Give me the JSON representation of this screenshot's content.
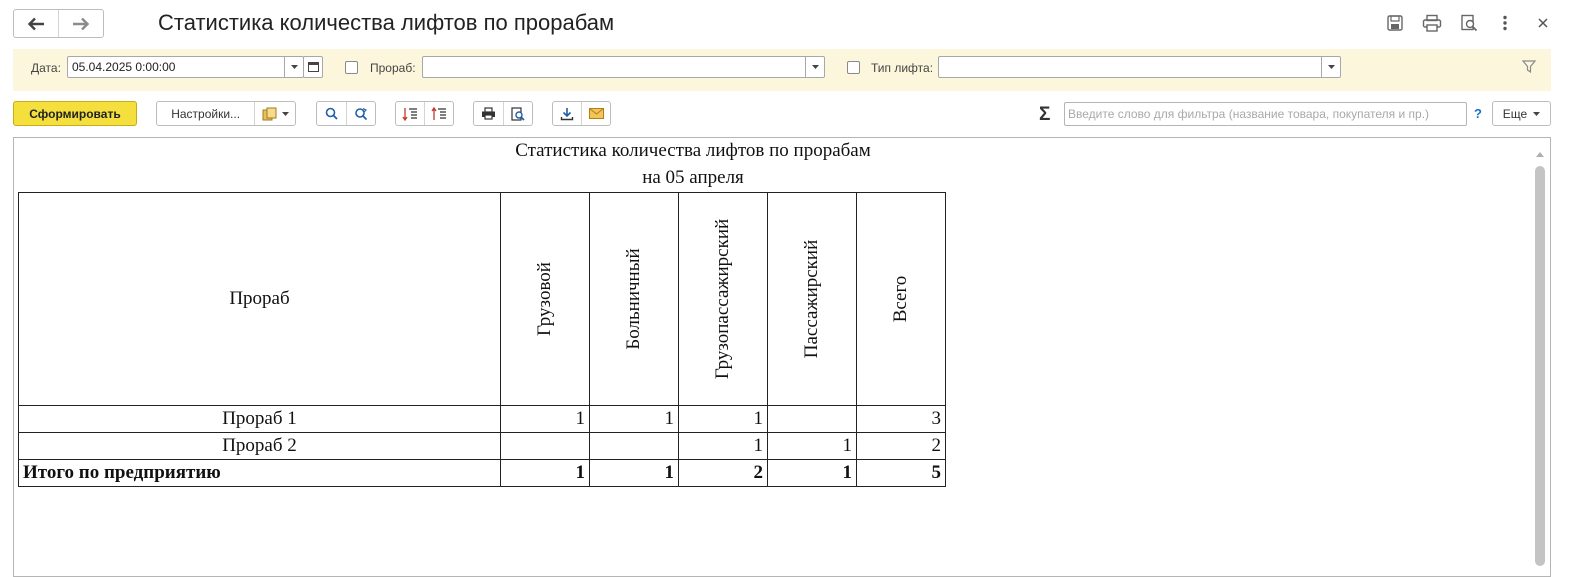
{
  "window": {
    "title": "Статистика количества лифтов по прорабам"
  },
  "filters": {
    "date_label": "Дата:",
    "date_value": "05.04.2025  0:00:00",
    "foreman_label": "Прораб:",
    "foreman_value": "",
    "lift_type_label": "Тип лифта:",
    "lift_type_value": ""
  },
  "toolbar": {
    "generate_label": "Сформировать",
    "settings_label": "Настройки...",
    "search_placeholder": "Введите слово для фильтра (название товара, покупателя и пр.)",
    "help_label": "?",
    "more_label": "Еще",
    "sum_label": "Σ"
  },
  "report": {
    "title": "Статистика количества лифтов по прорабам",
    "subtitle": "на 05 апреля",
    "columns": [
      "Прораб",
      "Грузовой",
      "Больничный",
      "Грузопассажирский",
      "Пассажирский",
      "Всего"
    ],
    "rows": [
      {
        "name": "Прораб 1",
        "values": [
          "1",
          "1",
          "1",
          "",
          "3"
        ]
      },
      {
        "name": "Прораб 2",
        "values": [
          "",
          "",
          "1",
          "1",
          "2"
        ]
      }
    ],
    "total": {
      "name": "Итого по предприятию",
      "values": [
        "1",
        "1",
        "2",
        "1",
        "5"
      ]
    }
  },
  "colors": {
    "accent_button": "#f5df3c",
    "filter_bar": "#fcf7dc",
    "link_blue": "#1a6fc4"
  }
}
